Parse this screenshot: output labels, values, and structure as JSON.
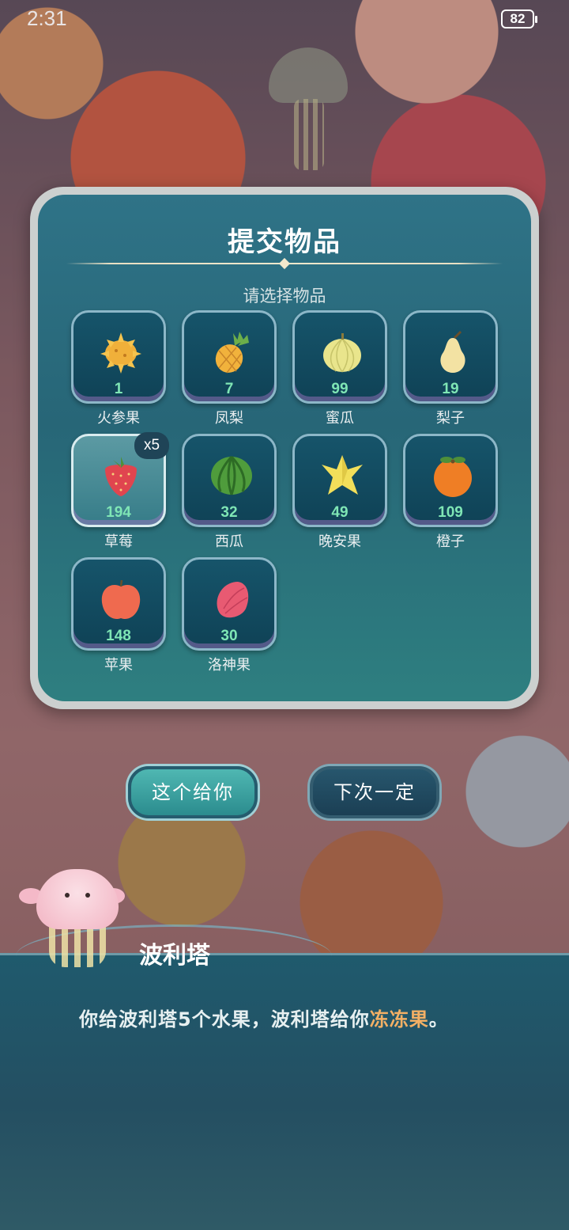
{
  "status_bar": {
    "time": "2:31",
    "battery": "82"
  },
  "dialog": {
    "title": "提交物品",
    "subtitle": "请选择物品",
    "items": [
      {
        "name": "火参果",
        "count": "1",
        "icon": "kiwano-icon",
        "color": "#f0b03a"
      },
      {
        "name": "凤梨",
        "count": "7",
        "icon": "pineapple-icon",
        "color": "#f1b23c"
      },
      {
        "name": "蜜瓜",
        "count": "99",
        "icon": "melon-icon",
        "color": "#e9e58c"
      },
      {
        "name": "梨子",
        "count": "19",
        "icon": "pear-icon",
        "color": "#f3e2a3"
      },
      {
        "name": "草莓",
        "count": "194",
        "icon": "strawberry-icon",
        "color": "#e0454f",
        "selected": true,
        "badge": "x5"
      },
      {
        "name": "西瓜",
        "count": "32",
        "icon": "watermelon-icon",
        "color": "#4f9c3c"
      },
      {
        "name": "晚安果",
        "count": "49",
        "icon": "starfruit-icon",
        "color": "#f2df5a"
      },
      {
        "name": "橙子",
        "count": "109",
        "icon": "orange-icon",
        "color": "#ef7e25"
      },
      {
        "name": "苹果",
        "count": "148",
        "icon": "apple-icon",
        "color": "#ef6a4f"
      },
      {
        "name": "洛神果",
        "count": "30",
        "icon": "roselle-icon",
        "color": "#e85a72"
      }
    ]
  },
  "buttons": {
    "give": "这个给你",
    "next_time": "下次一定"
  },
  "dialogue": {
    "speaker": "波利塔",
    "text_before": "你给波利塔5个水果，波利塔给你",
    "highlight": "冻冻果",
    "text_after": "。"
  },
  "colors": {
    "highlight": "#f3b065",
    "count": "#7fe6b5"
  }
}
